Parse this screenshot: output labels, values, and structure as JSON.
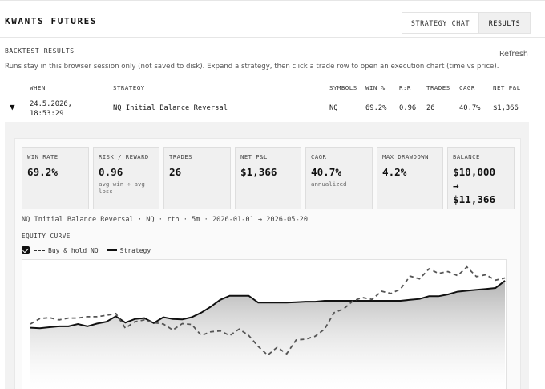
{
  "app": {
    "title": "KWANTS FUTURES"
  },
  "tabs": [
    {
      "label": "STRATEGY CHAT",
      "active": false
    },
    {
      "label": "RESULTS",
      "active": true
    }
  ],
  "results": {
    "title": "BACKTEST RESULTS",
    "refresh_label": "Refresh",
    "description": "Runs stay in this browser session only (not saved to disk). Expand a strategy, then click a trade row to open an execution chart (time vs price)."
  },
  "table": {
    "columns": [
      "WHEN",
      "STRATEGY",
      "SYMBOLS",
      "WIN %",
      "R:R",
      "TRADES",
      "CAGR",
      "NET P&L"
    ],
    "rows": [
      {
        "expanded": true,
        "when_date": "24.5.2026,",
        "when_time": "18:53:29",
        "strategy": "NQ Initial Balance Reversal",
        "symbols": "NQ",
        "win_pct": "69.2%",
        "rr": "0.96",
        "trades": "26",
        "cagr": "40.7%",
        "net_pnl": "$1,366"
      }
    ]
  },
  "metrics": [
    {
      "label": "WIN RATE",
      "value": "69.2%",
      "sub": ""
    },
    {
      "label": "RISK / REWARD",
      "value": "0.96",
      "sub": "avg win ÷ avg loss"
    },
    {
      "label": "TRADES",
      "value": "26",
      "sub": ""
    },
    {
      "label": "NET P&L",
      "value": "$1,366",
      "sub": ""
    },
    {
      "label": "CAGR",
      "value": "40.7%",
      "sub": "annualized"
    },
    {
      "label": "MAX DRAWDOWN",
      "value": "4.2%",
      "sub": ""
    },
    {
      "label": "BALANCE",
      "value": "$10,000",
      "arrow": "→",
      "value2": "$11,366",
      "sub": ""
    }
  ],
  "run_info": "NQ Initial Balance Reversal · NQ · rth · 5m · 2026-01-01 → 2026-05-20",
  "equity": {
    "label": "EQUITY CURVE",
    "legend_buy_hold": "Buy & hold NQ",
    "legend_strategy": "Strategy",
    "buy_hold_checked": true
  },
  "colors": {
    "accent": "#111111",
    "panel_bg": "#f2f2f2",
    "card_bg": "#f0f0f0"
  },
  "chart_data": {
    "type": "line",
    "x": [
      0,
      1,
      2,
      3,
      4,
      5,
      6,
      7,
      8,
      9,
      10,
      11,
      12,
      13,
      14,
      15,
      16,
      17,
      18,
      19,
      20,
      21,
      22,
      23,
      24,
      25,
      26,
      27,
      28,
      29,
      30,
      31,
      32,
      33,
      34,
      35,
      36,
      37,
      38,
      39,
      40,
      41,
      42,
      43,
      44,
      45,
      46,
      47,
      48,
      49,
      50
    ],
    "series": [
      {
        "name": "Strategy",
        "style": "solid",
        "values": [
          0.27,
          0.26,
          0.28,
          0.3,
          0.3,
          0.35,
          0.3,
          0.36,
          0.4,
          0.52,
          0.38,
          0.46,
          0.48,
          0.37,
          0.5,
          0.46,
          0.45,
          0.5,
          0.6,
          0.73,
          0.88,
          0.97,
          0.97,
          0.97,
          0.82,
          0.82,
          0.82,
          0.82,
          0.83,
          0.84,
          0.84,
          0.86,
          0.86,
          0.86,
          0.86,
          0.86,
          0.86,
          0.86,
          0.86,
          0.86,
          0.88,
          0.9,
          0.96,
          0.96,
          1.0,
          1.06,
          1.08,
          1.1,
          1.12,
          1.14,
          1.3
        ]
      },
      {
        "name": "Buy & hold NQ",
        "style": "dashed",
        "values": [
          0.35,
          0.47,
          0.49,
          0.44,
          0.48,
          0.48,
          0.51,
          0.51,
          0.54,
          0.58,
          0.26,
          0.4,
          0.44,
          0.38,
          0.35,
          0.22,
          0.36,
          0.34,
          0.1,
          0.18,
          0.2,
          0.1,
          0.24,
          0.1,
          -0.14,
          -0.33,
          -0.16,
          -0.3,
          0.0,
          0.02,
          0.08,
          0.24,
          0.6,
          0.68,
          0.86,
          0.93,
          0.89,
          1.07,
          1.02,
          1.12,
          1.4,
          1.34,
          1.56,
          1.46,
          1.5,
          1.41,
          1.6,
          1.39,
          1.43,
          1.31,
          1.36
        ]
      }
    ]
  }
}
